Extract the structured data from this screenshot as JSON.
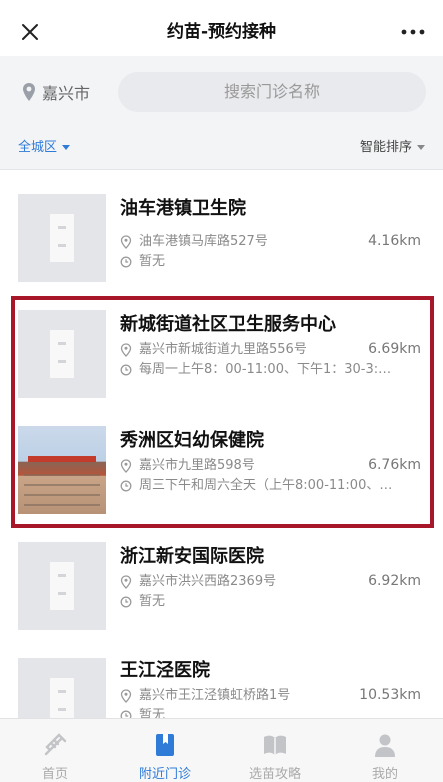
{
  "header": {
    "title": "约苗-预约接种"
  },
  "search": {
    "city": "嘉兴市",
    "placeholder": "搜索门诊名称"
  },
  "filters": {
    "region": "全城区",
    "sort": "智能排序"
  },
  "clinics": [
    {
      "name": "油车港镇卫生院",
      "address": "油车港镇马库路527号",
      "distance": "4.16km",
      "hours": "暂无",
      "image": "placeholder"
    },
    {
      "name": "新城街道社区卫生服务中心",
      "address": "嘉兴市新城街道九里路556号",
      "distance": "6.69km",
      "hours": "每周一上午8：00-11:00、下午1：30-3:…",
      "image": "placeholder"
    },
    {
      "name": "秀洲区妇幼保健院",
      "address": "嘉兴市九里路598号",
      "distance": "6.76km",
      "hours": "周三下午和周六全天（上午8:00-11:00、…",
      "image": "photo"
    },
    {
      "name": "浙江新安国际医院",
      "address": "嘉兴市洪兴西路2369号",
      "distance": "6.92km",
      "hours": "暂无",
      "image": "placeholder"
    },
    {
      "name": "王江泾医院",
      "address": "嘉兴市王江泾镇虹桥路1号",
      "distance": "10.53km",
      "hours": "暂无",
      "image": "placeholder"
    }
  ],
  "tabbar": [
    {
      "label": "首页",
      "icon": "syringe-icon",
      "active": false
    },
    {
      "label": "附近门诊",
      "icon": "bookmark-icon",
      "active": true
    },
    {
      "label": "选苗攻略",
      "icon": "book-icon",
      "active": false
    },
    {
      "label": "我的",
      "icon": "person-icon",
      "active": false
    }
  ],
  "colors": {
    "accent": "#2f7bd8",
    "highlight_border": "#a8162a",
    "background": "#f3f4f6"
  }
}
